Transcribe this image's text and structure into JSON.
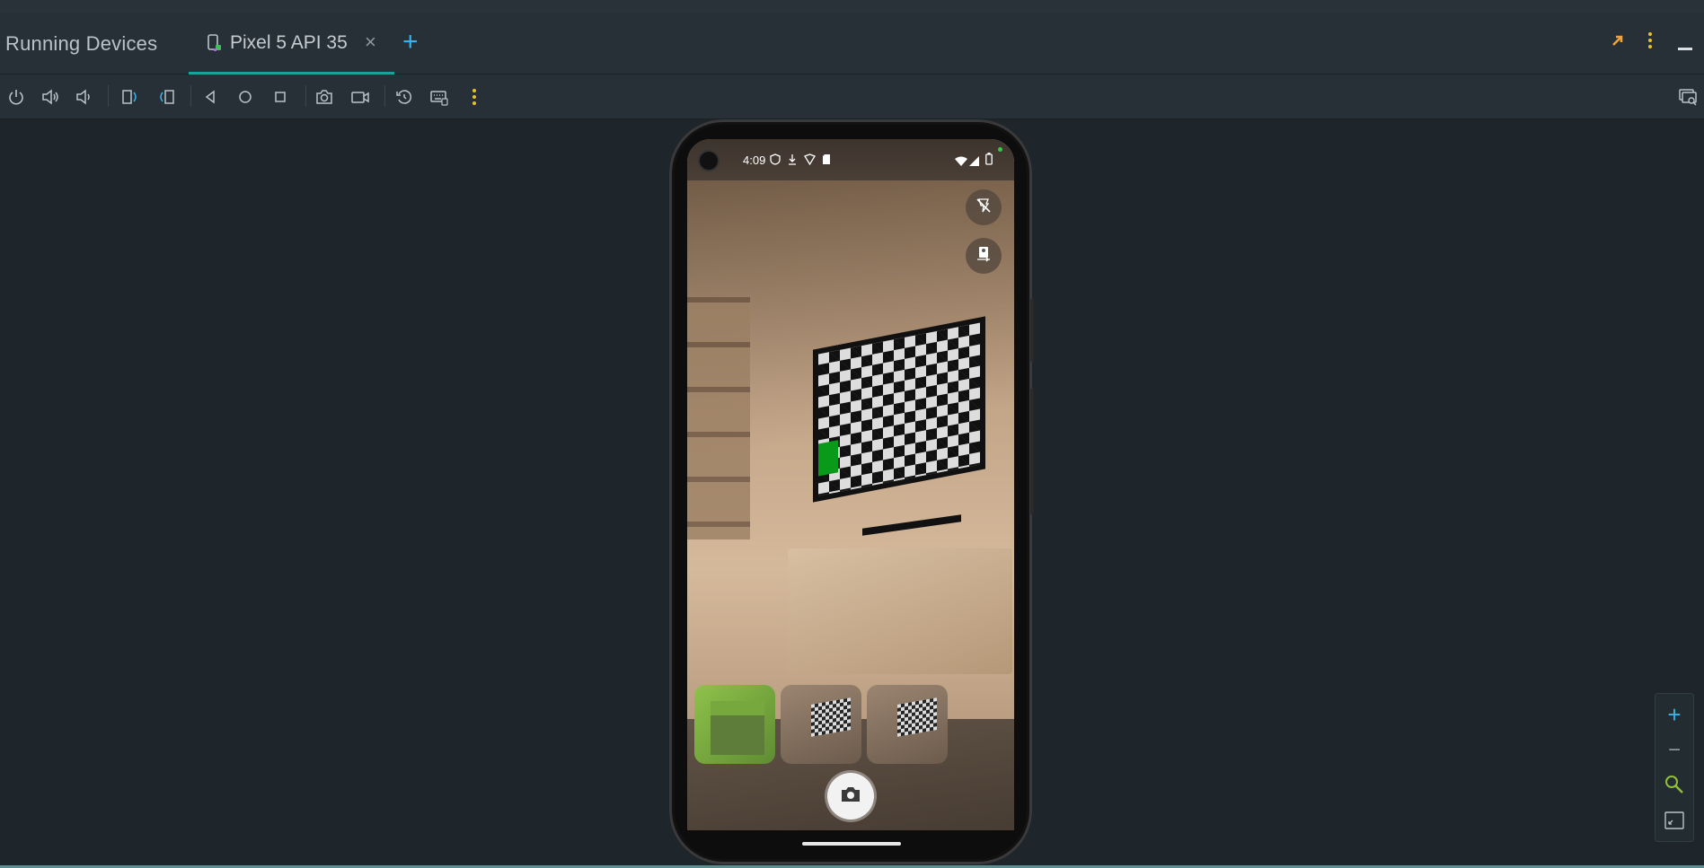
{
  "window": {
    "panel_title": "Running Devices",
    "tab": {
      "label": "Pixel 5 API 35",
      "close_glyph": "×",
      "icon": "device-mirror-icon"
    },
    "add_tab_glyph": "+",
    "header_actions": [
      "external-arrow-icon",
      "more-vertical-icon",
      "minimize-icon"
    ]
  },
  "toolbar": {
    "buttons": [
      "power-icon",
      "volume-up-icon",
      "volume-down-icon",
      "rotate-left-icon",
      "rotate-right-icon",
      "back-icon",
      "home-icon",
      "overview-icon",
      "screenshot-icon",
      "screen-record-icon",
      "snapshot-restore-icon",
      "keyboard-icon",
      "more-vertical-icon"
    ],
    "right_button": "device-search-icon",
    "accent": "#e8c12d"
  },
  "device": {
    "status": {
      "time": "4:09",
      "left_icons": [
        "vpn-shield-icon",
        "download-icon",
        "shield-check-icon",
        "sd-card-icon"
      ],
      "right_icons": [
        "wifi-icon",
        "signal-icon",
        "battery-icon"
      ]
    },
    "camera_app": {
      "top_buttons": [
        "flash-off-icon",
        "switch-camera-icon"
      ],
      "thumbnails": [
        "android-robot-thumbnail",
        "tv-scene-thumbnail",
        "tv-scene-thumbnail"
      ],
      "shutter": "camera-icon"
    }
  },
  "zoom_controls": {
    "zoom_in_glyph": "+",
    "zoom_out_glyph": "−",
    "buttons": [
      "zoom-in-icon",
      "zoom-out-icon",
      "zoom-actual-icon",
      "zoom-fit-icon"
    ]
  },
  "colors": {
    "background": "#1f262b",
    "toolbar": "#263036",
    "tab_underline": "#1aa39a",
    "add_tab": "#36b3ea",
    "zoom_actual": "#8fbf3a"
  }
}
